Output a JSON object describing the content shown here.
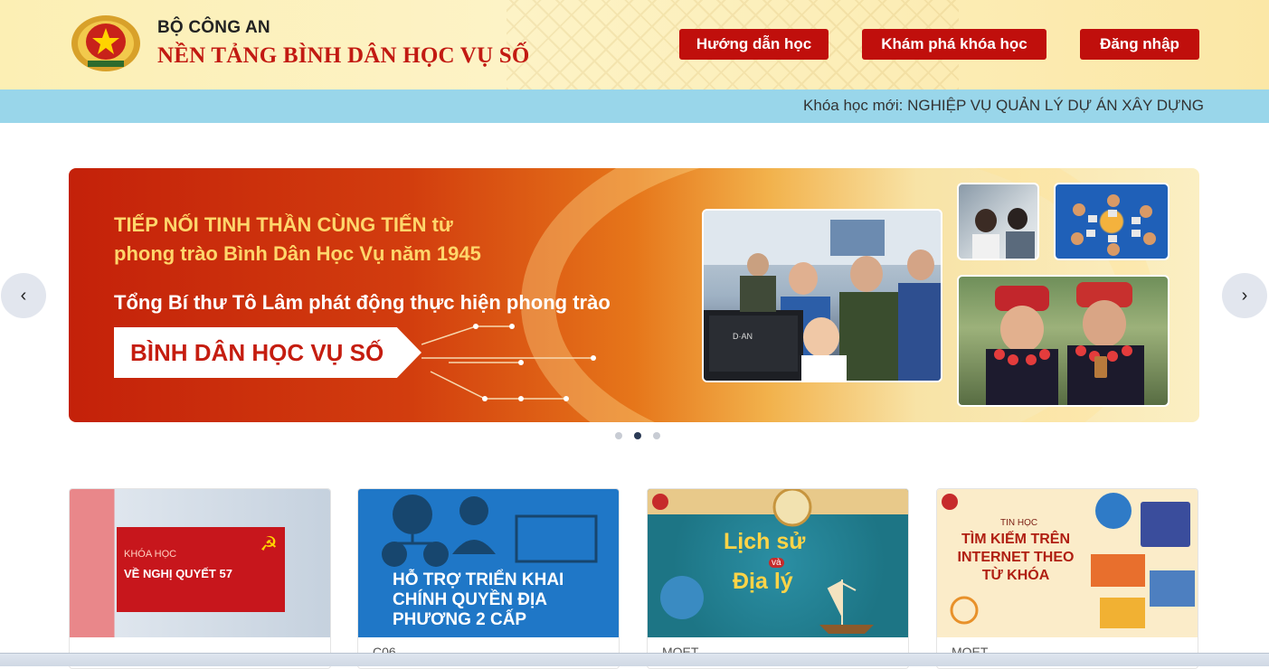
{
  "header": {
    "org": "BỘ CÔNG AN",
    "platform": "NỀN TẢNG BÌNH DÂN HỌC VỤ SỐ",
    "nav": [
      {
        "label": "Hướng dẫn học"
      },
      {
        "label": "Khám phá khóa học"
      },
      {
        "label": "Đăng nhập"
      }
    ]
  },
  "ticker": {
    "text": "Khóa học mới: NGHIỆP VỤ QUẢN LÝ DỰ ÁN XÂY DỰNG"
  },
  "banner": {
    "line1": "TIẾP NỐI TINH THẦN CÙNG TIẾN từ",
    "line2": "phong trào Bình Dân Học Vụ năm 1945",
    "line3": "Tổng Bí thư Tô Lâm phát động thực hiện phong trào",
    "tag": "BÌNH DÂN HỌC VỤ SỐ",
    "monitor_text": "D·AN",
    "prev_icon": "chevron-left-icon",
    "next_icon": "chevron-right-icon",
    "active_slide": 2,
    "slide_count": 3
  },
  "courses": [
    {
      "kicker": "KHÓA HỌC",
      "title": "VỀ NGHỊ QUYẾT 57",
      "source": ""
    },
    {
      "title": "HỖ TRỢ TRIỂN KHAI CHÍNH QUYỀN ĐỊA PHƯƠNG 2 CẤP",
      "source": "C06"
    },
    {
      "title_1": "Lịch sử",
      "conj": "và",
      "title_2": "Địa lý",
      "source": "MOET"
    },
    {
      "kicker": "TIN HỌC",
      "title": "TÌM KIẾM TRÊN INTERNET THEO TỪ KHÓA",
      "source": "MOET"
    }
  ],
  "colors": {
    "brand_red": "#c00f0c",
    "ticker_bg": "#99d6ea",
    "header_bg": "#fcefb4"
  }
}
